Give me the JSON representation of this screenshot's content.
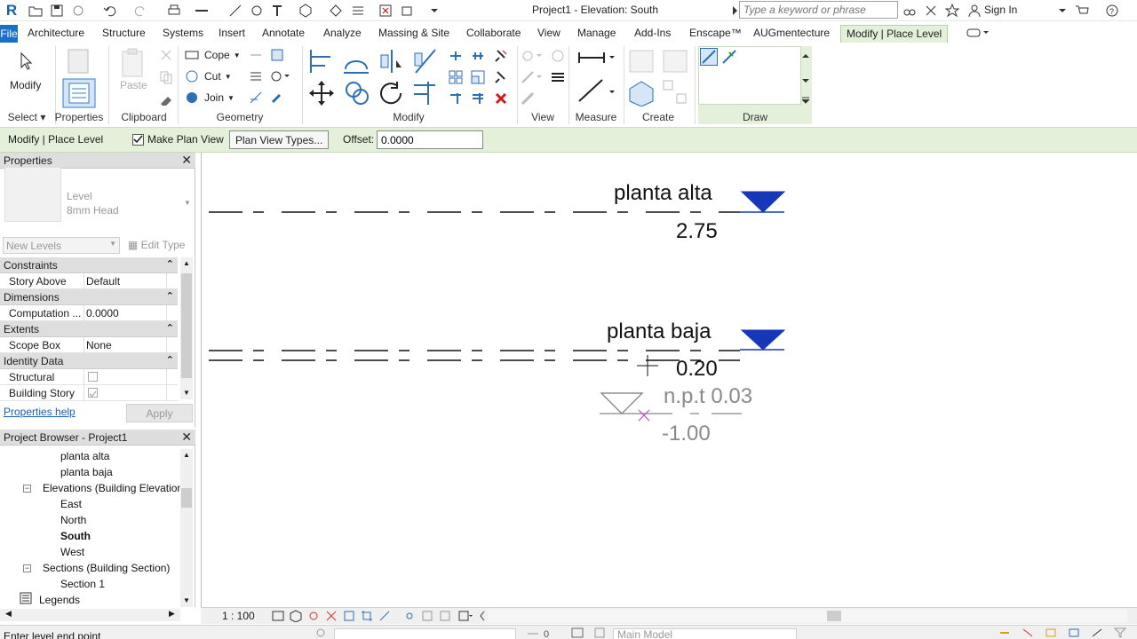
{
  "titlebar": {
    "app_icon": "R",
    "doc_title": "Project1 - Elevation: South",
    "search_placeholder": "Type a keyword or phrase",
    "signin": "Sign In"
  },
  "tabs": [
    {
      "label": "File"
    },
    {
      "label": "Architecture"
    },
    {
      "label": "Structure"
    },
    {
      "label": "Systems"
    },
    {
      "label": "Insert"
    },
    {
      "label": "Annotate"
    },
    {
      "label": "Analyze"
    },
    {
      "label": "Massing & Site"
    },
    {
      "label": "Collaborate"
    },
    {
      "label": "View"
    },
    {
      "label": "Manage"
    },
    {
      "label": "Add-Ins"
    },
    {
      "label": "Enscape™"
    },
    {
      "label": "AUGmentecture"
    },
    {
      "label": "Modify | Place Level"
    }
  ],
  "ribbon": {
    "modify_label": "Modify",
    "paste_label": "Paste",
    "cope_label": "Cope",
    "cut_label": "Cut",
    "join_label": "Join",
    "panels": {
      "select": "Select",
      "properties": "Properties",
      "clipboard": "Clipboard",
      "geometry": "Geometry",
      "modify": "Modify",
      "view": "View",
      "measure": "Measure",
      "create": "Create",
      "draw": "Draw"
    },
    "accent": "#e4f0da"
  },
  "options_bar": {
    "context": "Modify | Place Level",
    "make_plan_view_label": "Make Plan View",
    "make_plan_view_checked": true,
    "plan_view_types_button": "Plan View Types...",
    "offset_label": "Offset:",
    "offset_value": "0.0000"
  },
  "properties": {
    "title": "Properties",
    "type_name_1": "Level",
    "type_name_2": "8mm Head",
    "instance_filter": "New Levels",
    "edit_type": "Edit Type",
    "groups": [
      {
        "name": "Constraints",
        "rows": [
          {
            "key": "Story Above",
            "value": "Default"
          }
        ]
      },
      {
        "name": "Dimensions",
        "rows": [
          {
            "key": "Computation ...",
            "value": "0.0000"
          }
        ]
      },
      {
        "name": "Extents",
        "rows": [
          {
            "key": "Scope Box",
            "value": "None"
          }
        ]
      },
      {
        "name": "Identity Data",
        "rows": [
          {
            "key": "Structural",
            "value": ""
          },
          {
            "key": "Building Story",
            "value": ""
          }
        ]
      }
    ],
    "help_link": "Properties help",
    "apply_button": "Apply"
  },
  "project_browser": {
    "title": "Project Browser - Project1",
    "nodes": [
      {
        "label": "planta alta",
        "bold": false
      },
      {
        "label": "planta baja",
        "bold": false
      },
      {
        "label": "Elevations (Building Elevation)",
        "bold": false
      },
      {
        "label": "East",
        "bold": false
      },
      {
        "label": "North",
        "bold": false
      },
      {
        "label": "South",
        "bold": true
      },
      {
        "label": "West",
        "bold": false
      },
      {
        "label": "Sections (Building Section)",
        "bold": false
      },
      {
        "label": "Section 1",
        "bold": false
      },
      {
        "label": "Legends",
        "bold": false
      }
    ]
  },
  "canvas": {
    "levels": [
      {
        "name": "planta alta",
        "elevation": "2.75"
      },
      {
        "name": "planta baja",
        "elevation": "0.20"
      }
    ],
    "preview": {
      "name": "n.p.t 0.03",
      "elevation": "-1.00"
    },
    "level_head_color": "#1537b8"
  },
  "view_control": {
    "scale": "1 : 100"
  },
  "status": {
    "message": "Enter level end point",
    "zero": "0",
    "model": "Main Model"
  }
}
